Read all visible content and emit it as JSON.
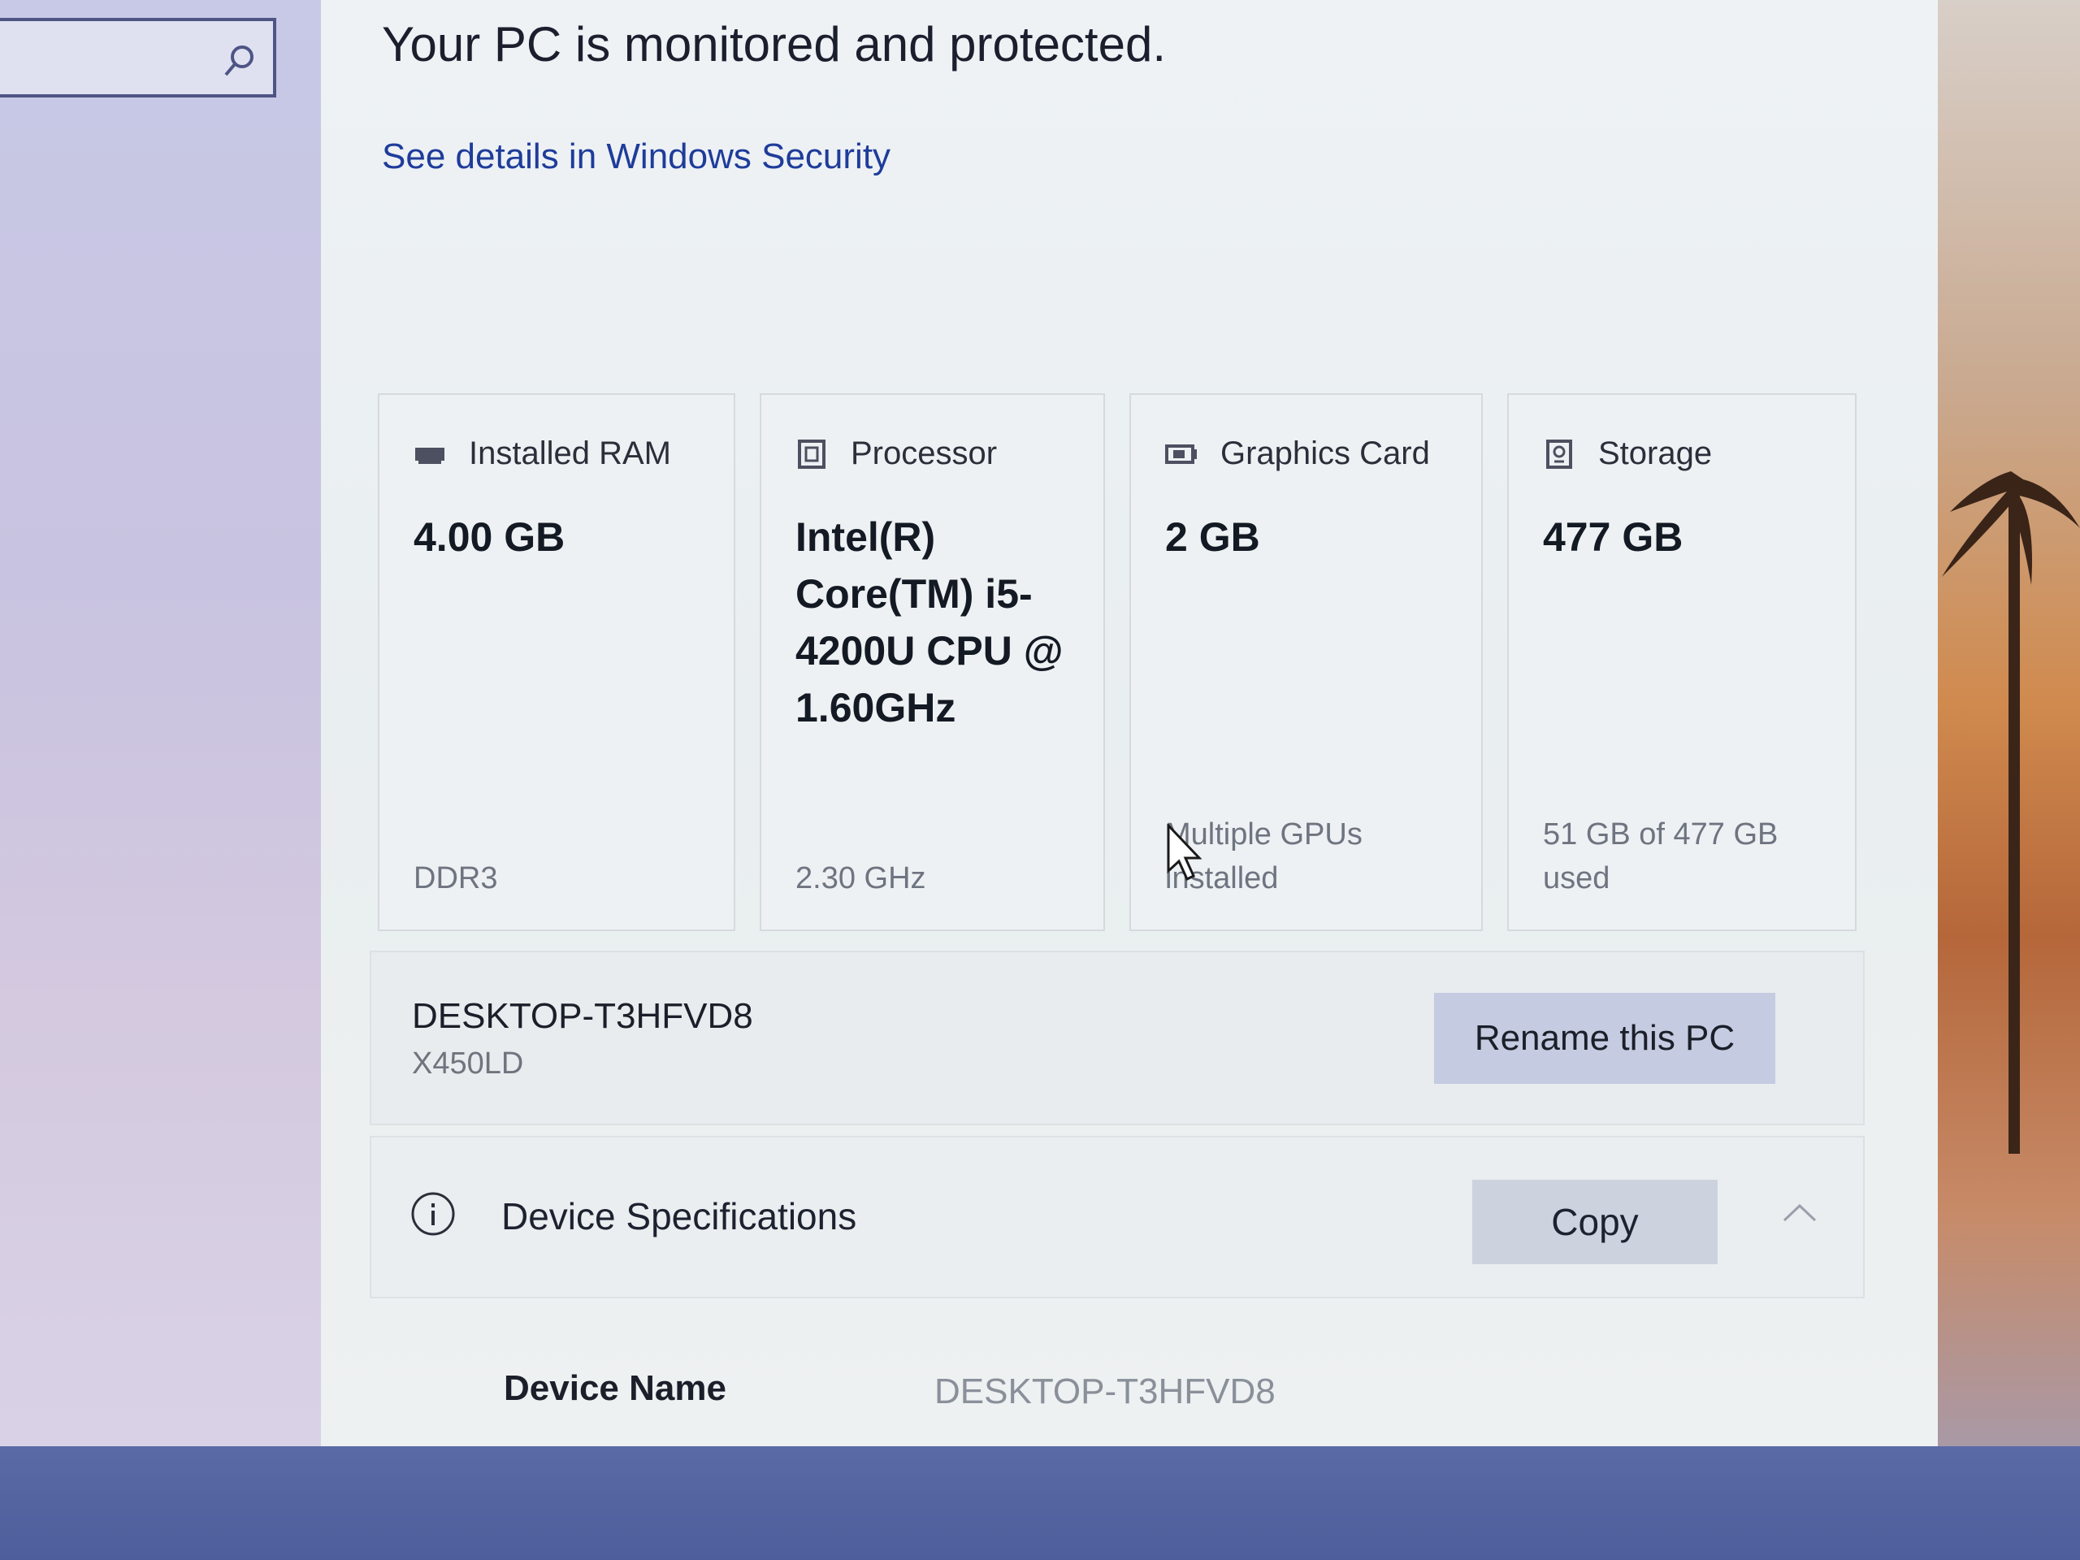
{
  "header": {
    "title": "Your PC is monitored and protected.",
    "security_link": "See details in Windows Security"
  },
  "cards": [
    {
      "label": "Installed RAM",
      "icon": "ram-icon",
      "value": "4.00 GB",
      "sub": "DDR3"
    },
    {
      "label": "Processor",
      "icon": "processor-icon",
      "value": "Intel(R) Core(TM) i5-4200U CPU @ 1.60GHz",
      "sub": "2.30 GHz"
    },
    {
      "label": "Graphics Card",
      "icon": "graphics-card-icon",
      "value": "2 GB",
      "sub": "Multiple GPUs installed"
    },
    {
      "label": "Storage",
      "icon": "storage-icon",
      "value": "477 GB",
      "sub": "51 GB of 477 GB used"
    }
  ],
  "device": {
    "name": "DESKTOP-T3HFVD8",
    "model": "X450LD",
    "rename_label": "Rename this PC"
  },
  "specs": {
    "title": "Device Specifications",
    "copy_label": "Copy",
    "rows": [
      {
        "key": "Device Name",
        "value": "DESKTOP-T3HFVD8"
      }
    ]
  },
  "colors": {
    "link": "#1e3c9a",
    "button": "#c5cbe0"
  }
}
